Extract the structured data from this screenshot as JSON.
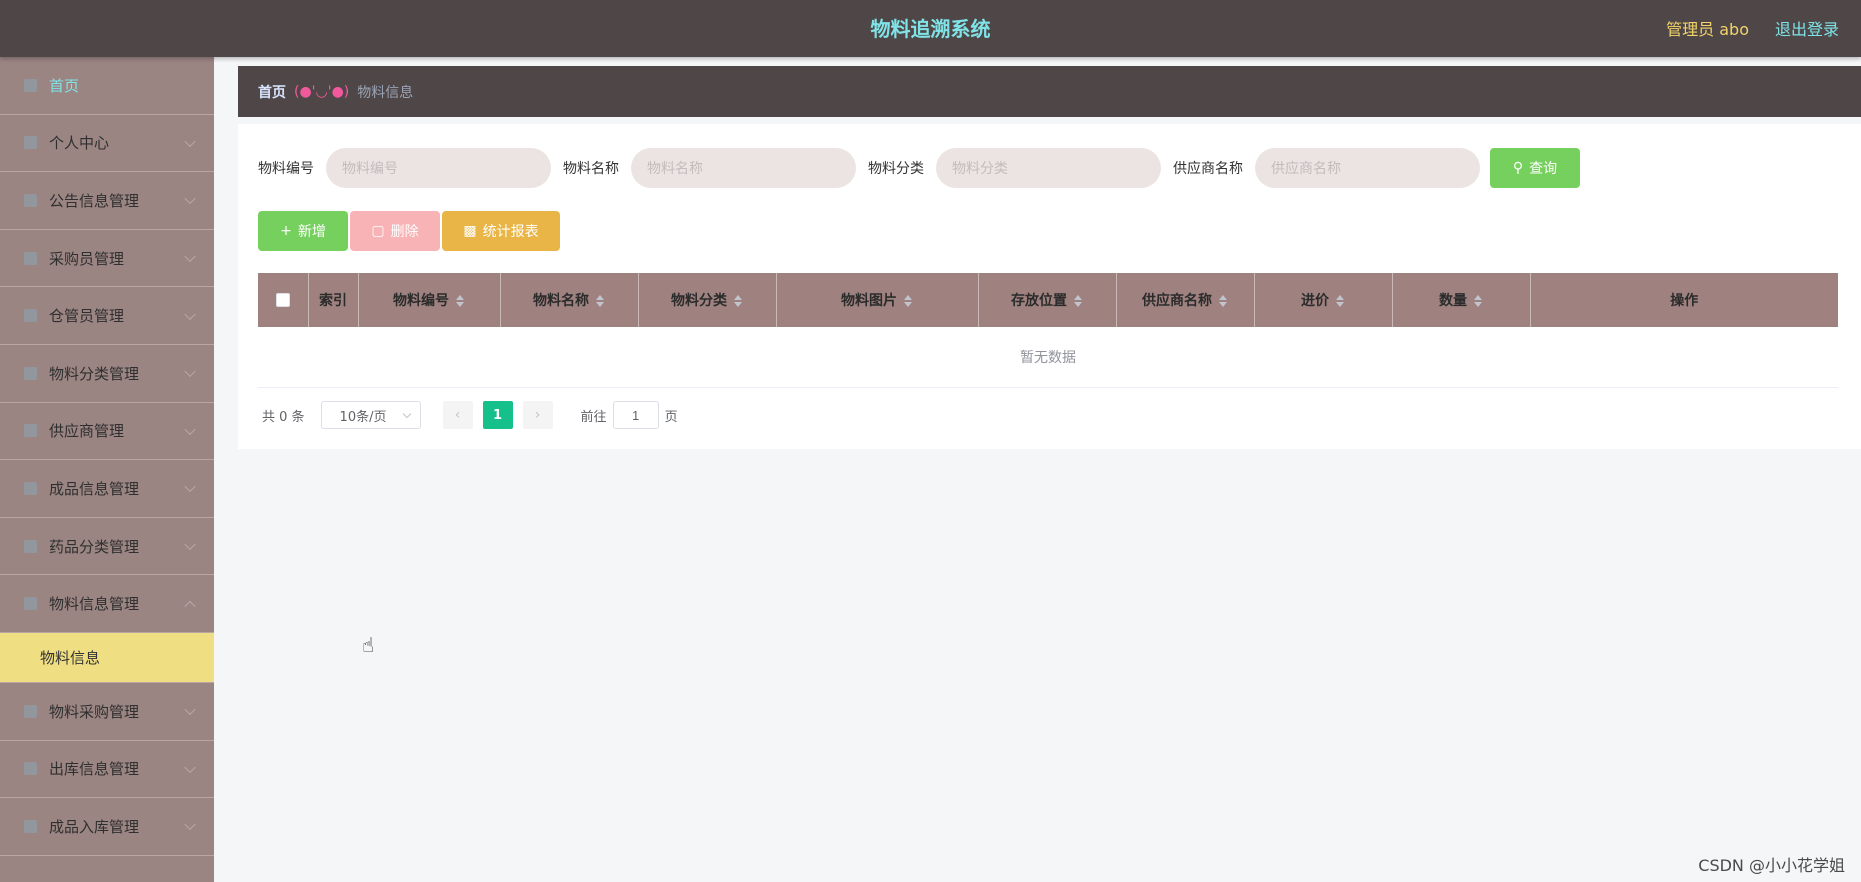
{
  "header": {
    "title": "物料追溯系统",
    "admin": "管理员 abo",
    "logout": "退出登录"
  },
  "sidebar": {
    "items": [
      {
        "label": "首页",
        "icon": "home-icon"
      },
      {
        "label": "个人中心",
        "icon": "user-icon"
      },
      {
        "label": "公告信息管理",
        "icon": "send-icon"
      },
      {
        "label": "采购员管理",
        "icon": "user-icon"
      },
      {
        "label": "仓管员管理",
        "icon": "location-icon"
      },
      {
        "label": "物料分类管理",
        "icon": "clock-icon"
      },
      {
        "label": "供应商管理",
        "icon": "circle-icon"
      },
      {
        "label": "成品信息管理",
        "icon": "monitor-icon"
      },
      {
        "label": "药品分类管理",
        "icon": "grid-icon"
      },
      {
        "label": "物料信息管理",
        "icon": "folder-icon"
      },
      {
        "label": "物料采购管理",
        "icon": "card-icon"
      },
      {
        "label": "出库信息管理",
        "icon": "box-icon"
      },
      {
        "label": "成品入库管理",
        "icon": "apps-icon"
      }
    ],
    "submenu": {
      "label": "物料信息"
    }
  },
  "breadcrumb": {
    "home": "首页",
    "separator": "(●'◡'●)",
    "current": "物料信息"
  },
  "search": {
    "fields": [
      {
        "label": "物料编号",
        "placeholder": "物料编号"
      },
      {
        "label": "物料名称",
        "placeholder": "物料名称"
      },
      {
        "label": "物料分类",
        "placeholder": "物料分类"
      },
      {
        "label": "供应商名称",
        "placeholder": "供应商名称"
      }
    ],
    "query_button": "查询"
  },
  "actions": {
    "add": "新增",
    "delete": "删除",
    "report": "统计报表"
  },
  "table": {
    "columns": [
      "索引",
      "物料编号",
      "物料名称",
      "物料分类",
      "物料图片",
      "存放位置",
      "供应商名称",
      "进价",
      "数量",
      "操作"
    ],
    "empty_text": "暂无数据"
  },
  "pagination": {
    "total": "共 0 条",
    "page_size": "10条/页",
    "current_page": "1",
    "goto_label": "前往",
    "goto_value": "1",
    "page_suffix": "页"
  },
  "watermark": "CSDN @小小花学姐",
  "colors": {
    "header_bg": "#4f4747",
    "sidebar_bg": "#9b8583",
    "active_submenu": "#f0df82",
    "title_color": "#7fe3e8",
    "table_header": "#9f8280",
    "query_button": "#75d05d",
    "pager_active": "#16c08a"
  }
}
